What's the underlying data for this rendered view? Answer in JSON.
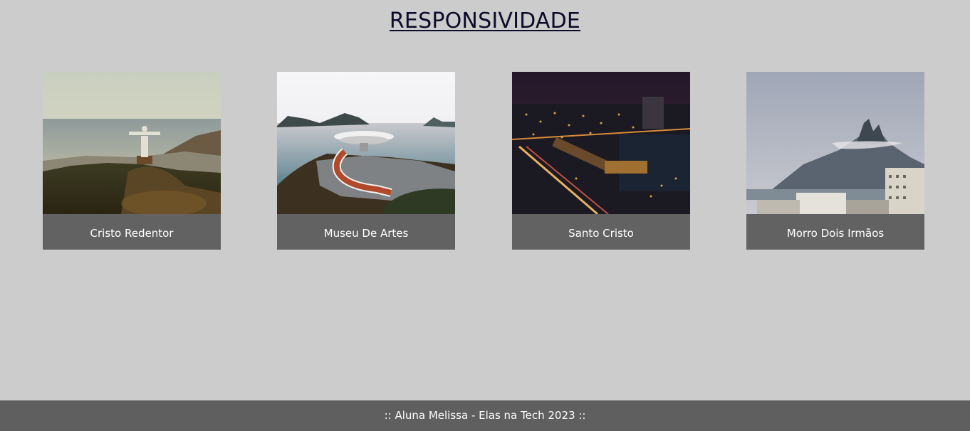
{
  "header": {
    "title": "RESPONSIVIDADE"
  },
  "cards": [
    {
      "caption": "Cristo Redentor",
      "image": "cristo-redentor-photo"
    },
    {
      "caption": "Museu De Artes",
      "image": "museu-de-artes-photo"
    },
    {
      "caption": "Santo Cristo",
      "image": "santo-cristo-photo"
    },
    {
      "caption": "Morro Dois Irmãos",
      "image": "morro-dois-irmaos-photo"
    }
  ],
  "footer": {
    "text": ":: Aluna Melissa - Elas na Tech 2023 ::"
  },
  "colors": {
    "background": "#cccccc",
    "card_caption_bg": "#626262",
    "footer_bg": "#5f5f5f",
    "title": "#0b0b2a"
  }
}
